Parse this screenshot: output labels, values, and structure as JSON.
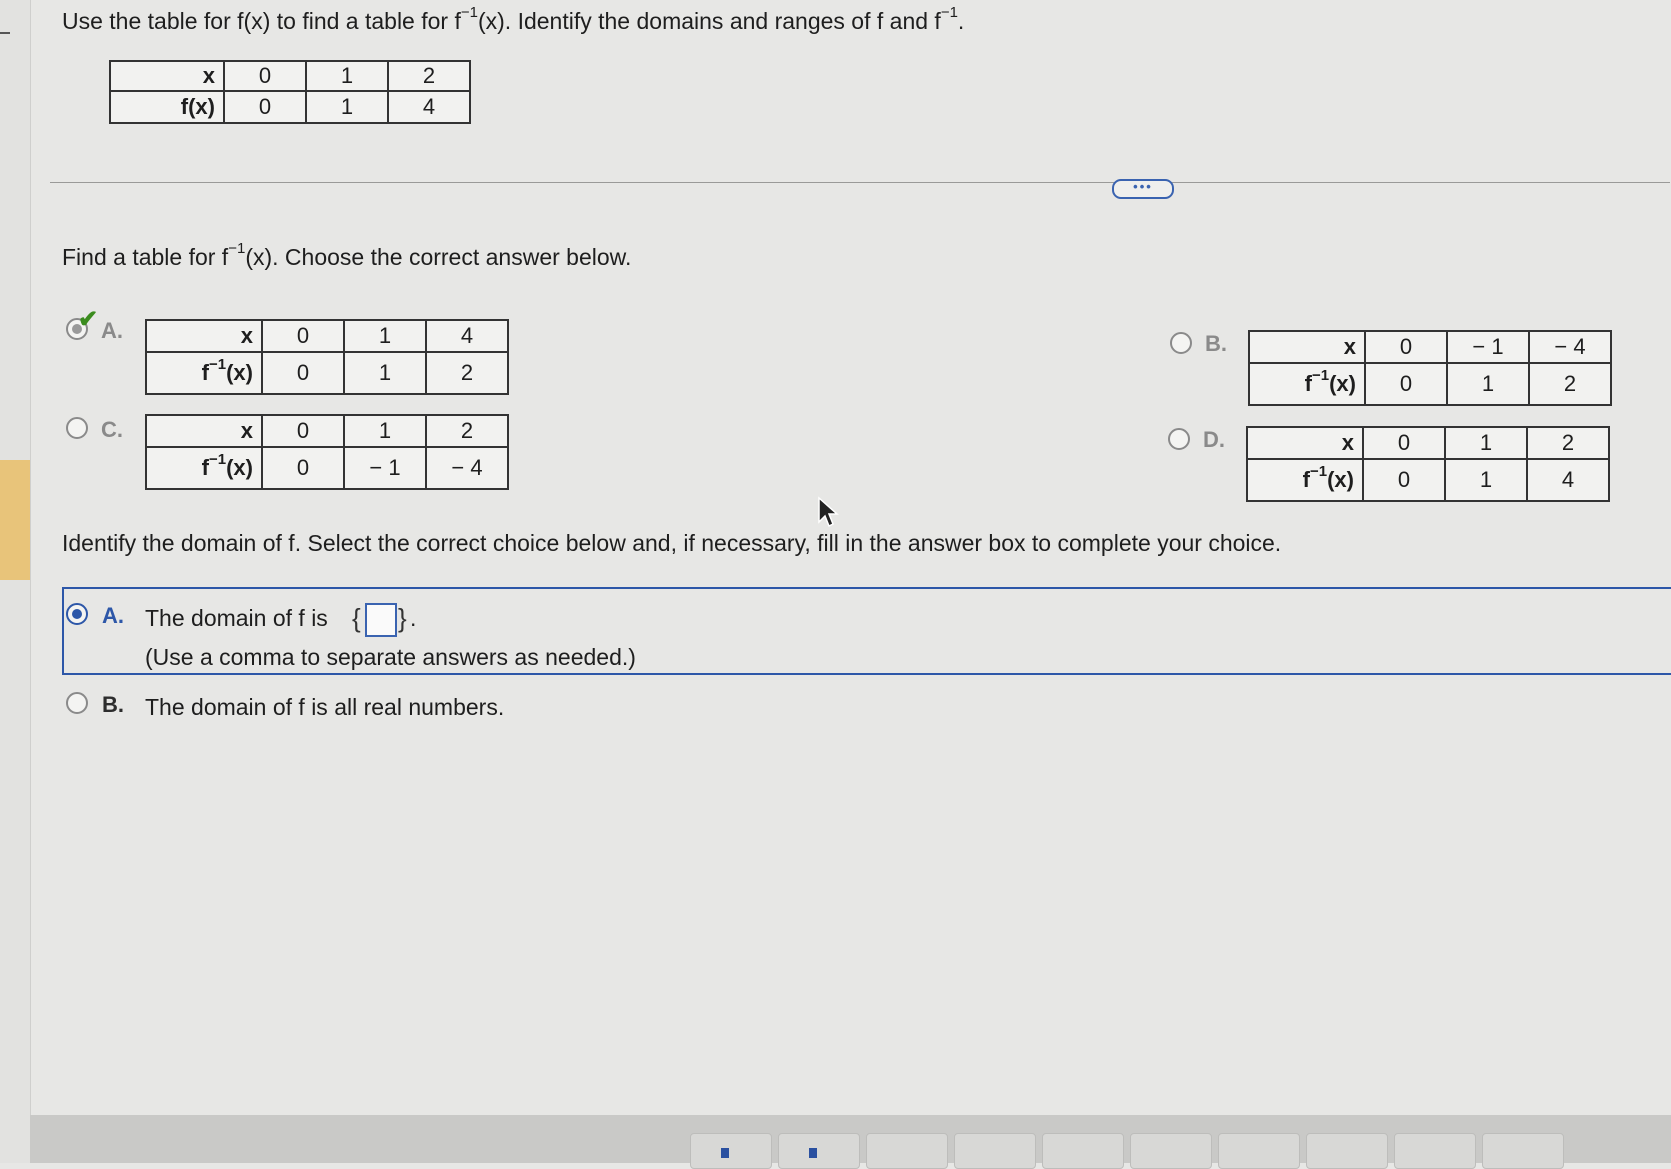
{
  "question": {
    "prefix": "Use the table for f(x) to find a table for f",
    "sup1": "−1",
    "middle": "(x). Identify the domains and ranges of f and f",
    "sup2": "−1",
    "suffix": "."
  },
  "given_table": {
    "row1": [
      "x",
      "0",
      "1",
      "2"
    ],
    "row2": [
      "f(x)",
      "0",
      "1",
      "4"
    ]
  },
  "divider_dots": "•••",
  "part1": {
    "prefix": "Find a table for f",
    "sup": "−1",
    "suffix": "(x). Choose the correct answer below."
  },
  "inv_label": {
    "f": "f",
    "sup": "−1",
    "x": "(x)"
  },
  "options1": {
    "A": {
      "label": "A.",
      "xs": [
        "x",
        "0",
        "1",
        "4"
      ],
      "ys": [
        "0",
        "1",
        "2"
      ]
    },
    "B": {
      "label": "B.",
      "xs": [
        "x",
        "0",
        "− 1",
        "− 4"
      ],
      "ys": [
        "0",
        "1",
        "2"
      ]
    },
    "C": {
      "label": "C.",
      "xs": [
        "x",
        "0",
        "1",
        "2"
      ],
      "ys": [
        "0",
        "− 1",
        "− 4"
      ]
    },
    "D": {
      "label": "D.",
      "xs": [
        "x",
        "0",
        "1",
        "2"
      ],
      "ys": [
        "0",
        "1",
        "4"
      ]
    }
  },
  "part2": {
    "prompt": "Identify the domain of f. Select the correct choice below and, if necessary, fill in the answer box to complete your choice.",
    "A_label": "A.",
    "A_text": "The domain of f is",
    "A_open": "{",
    "A_close": "}",
    "A_end": ".",
    "A_hint": "(Use a comma to separate answers as needed.)",
    "A_value": "",
    "B_label": "B.",
    "B_text": "The domain of f is all real numbers."
  },
  "colors": {
    "accent": "#2d57a8",
    "correct": "#3b8c1e"
  }
}
